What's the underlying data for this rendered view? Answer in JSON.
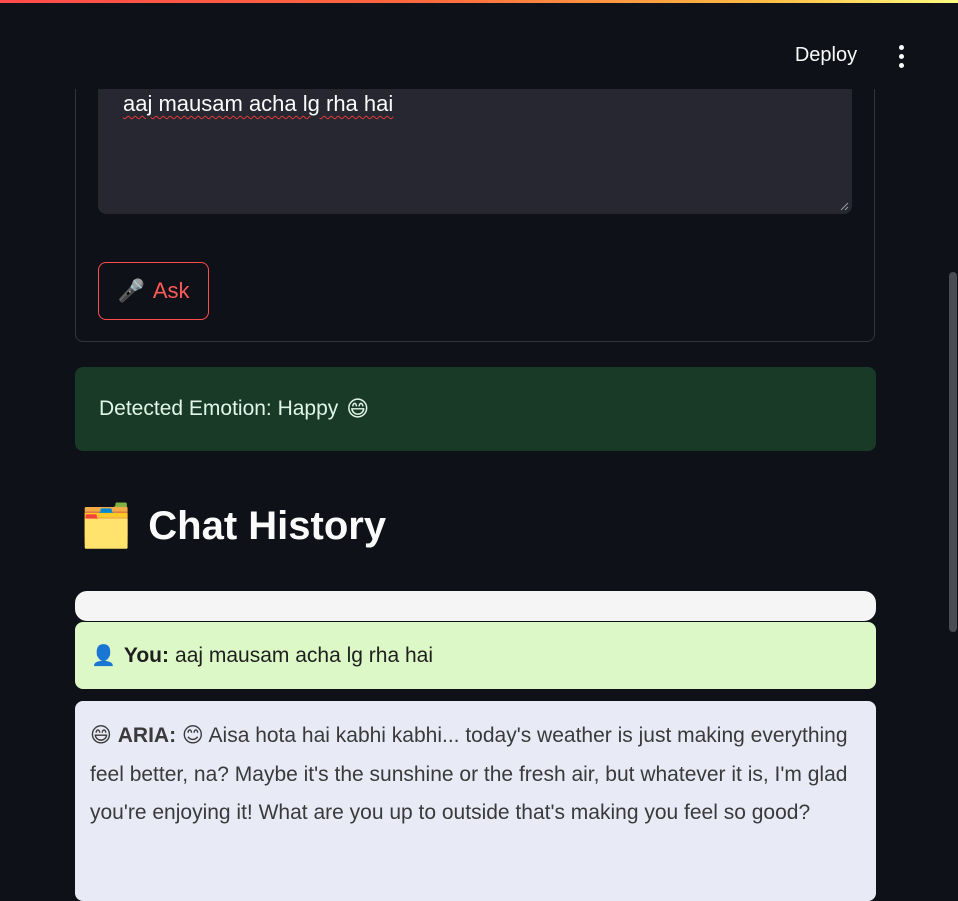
{
  "header": {
    "deploy_label": "Deploy",
    "menu_icon": "kebab-menu-icon"
  },
  "colors": {
    "accent": "#ff4b4b",
    "background": "#0e1117",
    "emotion_bg": "#1a3a28",
    "user_bubble_bg": "#dcf8c6",
    "aria_bubble_bg": "#e8eaf6"
  },
  "input": {
    "value": "aaj mausam acha lg rha hai"
  },
  "ask_button": {
    "icon": "🎤",
    "label": "Ask"
  },
  "emotion": {
    "text": "Detected Emotion: Happy",
    "emoji": "😄"
  },
  "chat_history": {
    "icon": "🗂️",
    "title": "Chat History",
    "messages": [
      {
        "avatar": "👤",
        "sender": "You:",
        "text": "aaj mausam acha lg rha hai"
      },
      {
        "avatar": "😄",
        "sender": "ARIA:",
        "emoji": "😊",
        "text": "Aisa hota hai kabhi kabhi... today's weather is just making everything feel better, na? Maybe it's the sunshine or the fresh air, but whatever it is, I'm glad you're enjoying it! What are you up to outside that's making you feel so good?"
      }
    ]
  }
}
